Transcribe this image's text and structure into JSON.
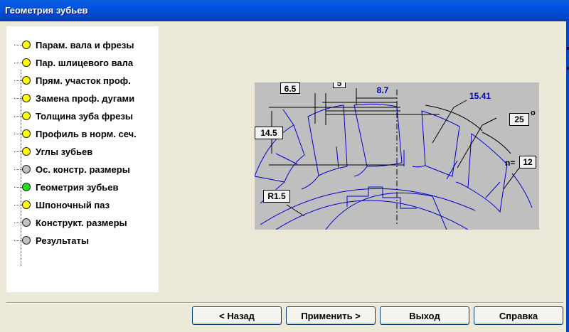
{
  "window": {
    "title": "Геометрия зубьев"
  },
  "tree": {
    "items": [
      {
        "label": "Парам. вала и фрезы",
        "status_color": "#FFFF00"
      },
      {
        "label": "Пар. шлицевого вала",
        "status_color": "#FFFF00"
      },
      {
        "label": "Прям. участок проф.",
        "status_color": "#FFFF00"
      },
      {
        "label": "Замена проф. дугами",
        "status_color": "#FFFF00"
      },
      {
        "label": "Толщина зуба фрезы",
        "status_color": "#FFFF00"
      },
      {
        "label": "Профиль в норм. сеч.",
        "status_color": "#FFFF00"
      },
      {
        "label": "Углы зубьев",
        "status_color": "#FFFF00"
      },
      {
        "label": "Ос. констр. размеры",
        "status_color": "#C0C0C0"
      },
      {
        "label": "Геометрия зубьев",
        "status_color": "#22DD22"
      },
      {
        "label": "Шпоночный паз",
        "status_color": "#FFFF00"
      },
      {
        "label": "Конструкт. размеры",
        "status_color": "#C0C0C0"
      },
      {
        "label": "Результаты",
        "status_color": "#C0C0C0"
      }
    ]
  },
  "drawing": {
    "dim_6_5": "6.5",
    "dim_5": "5",
    "dim_8_7": "8.7",
    "dim_15_41": "15.41",
    "dim_25": "25",
    "deg_symbol": "o",
    "dim_14_5": "14.5",
    "n_label": "n=",
    "dim_12": "12",
    "dim_r1_5": "R1.5"
  },
  "buttons": {
    "back": "< Назад",
    "apply": "Применить >",
    "exit": "Выход",
    "help": "Справка"
  }
}
